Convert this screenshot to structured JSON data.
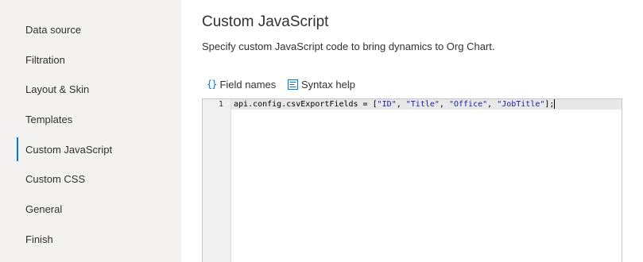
{
  "sidebar": {
    "items": [
      {
        "label": "Data source",
        "active": false
      },
      {
        "label": "Filtration",
        "active": false
      },
      {
        "label": "Layout & Skin",
        "active": false
      },
      {
        "label": "Templates",
        "active": false
      },
      {
        "label": "Custom JavaScript",
        "active": true
      },
      {
        "label": "Custom CSS",
        "active": false
      },
      {
        "label": "General",
        "active": false
      },
      {
        "label": "Finish",
        "active": false
      }
    ]
  },
  "main": {
    "title": "Custom JavaScript",
    "description": "Specify custom JavaScript code to bring dynamics to Org Chart.",
    "toolbar": {
      "field_names": {
        "label": "Field names",
        "icon": "braces-icon"
      },
      "syntax_help": {
        "label": "Syntax help",
        "icon": "syntax-help-icon"
      }
    },
    "editor": {
      "line_number": "1",
      "code_prefix": "api.config.csvExportFields = [",
      "strings": [
        "\"ID\"",
        "\"Title\"",
        "\"Office\"",
        "\"JobTitle\""
      ],
      "separator": ", ",
      "code_suffix": "];"
    }
  },
  "colors": {
    "accent": "#0078d4",
    "sidebar_bg": "#f3f2f1",
    "string": "#1a1aa6"
  }
}
